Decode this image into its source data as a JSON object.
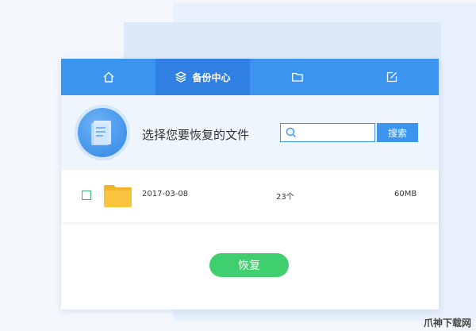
{
  "tabs": [
    {
      "icon": "home-icon",
      "label": ""
    },
    {
      "icon": "layers-icon",
      "label": "备份中心",
      "active": true
    },
    {
      "icon": "folder-icon",
      "label": ""
    },
    {
      "icon": "edit-icon",
      "label": ""
    }
  ],
  "header": {
    "title": "选择您要恢复的文件"
  },
  "search": {
    "placeholder": "",
    "value": "",
    "button_label": "搜索"
  },
  "files": [
    {
      "date": "2017-03-08",
      "count": "23个",
      "size": "60MB",
      "checked": false
    }
  ],
  "actions": {
    "restore_label": "恢复"
  },
  "colors": {
    "primary": "#3b95ef",
    "primary_active": "#2f80e1",
    "success": "#3fcf6e",
    "checkbox": "#3ab67b",
    "folder": "#f6be2f"
  },
  "watermark": "爪神下载网"
}
